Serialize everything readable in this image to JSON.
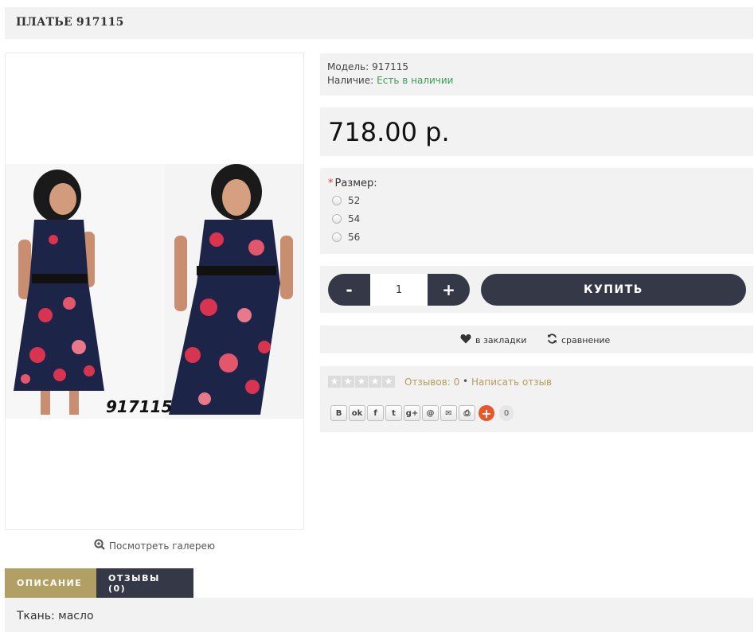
{
  "product": {
    "title": "ПЛАТЬЕ 917115",
    "photo_caption": "917115"
  },
  "info": {
    "model_label": "Модель:",
    "model_value": "917115",
    "stock_label": "Наличие:",
    "stock_value": "Есть в наличии"
  },
  "price": "718.00 р.",
  "size": {
    "required_mark": "*",
    "label": "Размер:",
    "options": [
      "52",
      "54",
      "56"
    ]
  },
  "cart": {
    "minus": "-",
    "quantity": "1",
    "plus": "+",
    "buy_label": "КУПИТЬ"
  },
  "actions": {
    "wishlist": "в закладки",
    "compare": "сравнение"
  },
  "reviews": {
    "rating": 0,
    "count_label": "Отзывов: 0",
    "separator": "•",
    "write_label": "Написать отзыв"
  },
  "share": {
    "buttons": [
      "vk-icon",
      "odnoklassniki-icon",
      "facebook-icon",
      "twitter-icon",
      "google-plus-icon",
      "mail-ru-icon",
      "email-icon",
      "print-icon"
    ],
    "count": "0"
  },
  "gallery_link": "Посмотреть галерею",
  "tabs": {
    "description": "ОПИСАНИЕ",
    "reviews": "ОТЗЫВЫ (0)"
  },
  "description_text": "Ткань: масло",
  "colors": {
    "accent_gold": "#b19f63",
    "dark_button": "#353846",
    "in_stock_green": "#3d9b58",
    "panel_bg": "#f2f2f2"
  }
}
